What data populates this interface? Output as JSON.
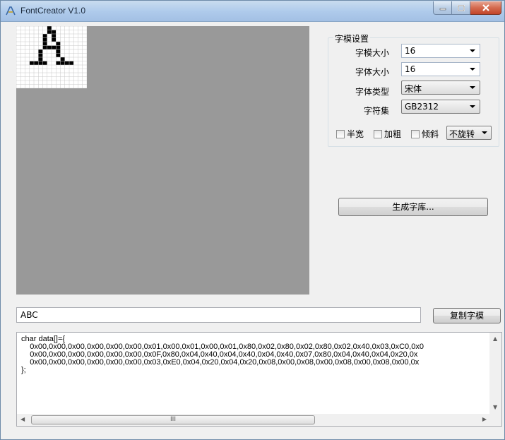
{
  "window": {
    "title": "FontCreator V1.0"
  },
  "settings": {
    "group_title": "字模设置",
    "font_matrix_size": {
      "label": "字模大小",
      "value": "16"
    },
    "font_size": {
      "label": "字体大小",
      "value": "16"
    },
    "font_type": {
      "label": "字体类型",
      "value": "宋体"
    },
    "charset": {
      "label": "字符集",
      "value": "GB2312"
    },
    "half_width": {
      "label": "半宽",
      "checked": false
    },
    "bold": {
      "label": "加粗",
      "checked": false
    },
    "italic": {
      "label": "倾斜",
      "checked": false
    },
    "rotation": {
      "value": "不旋转"
    }
  },
  "generate_button": "生成字库...",
  "text_input": {
    "value": "ABC"
  },
  "copy_button": "复制字模",
  "output": {
    "lines": [
      "char data[]={",
      "    0x00,0x00,0x00,0x00,0x00,0x00,0x01,0x00,0x01,0x00,0x01,0x80,0x02,0x80,0x02,0x80,0x02,0x40,0x03,0xC0,0x0",
      "    0x00,0x00,0x00,0x00,0x00,0x00,0x0F,0x80,0x04,0x40,0x04,0x40,0x04,0x40,0x07,0x80,0x04,0x40,0x04,0x20,0x",
      "    0x00,0x00,0x00,0x00,0x00,0x00,0x03,0xE0,0x04,0x20,0x04,0x20,0x08,0x00,0x08,0x00,0x08,0x00,0x08,0x00,0x",
      "};"
    ]
  },
  "hscroll_thumb_glyph": "III",
  "preview": {
    "grid_cols": 16,
    "grid_rows": 16,
    "glyph_rows": [
      "0000000100000000",
      "0000000110000000",
      "0000001010000000",
      "0000001010000000",
      "0000001001000000",
      "0000001111000000",
      "0000010001000000",
      "0000010001000000",
      "0000010000100000",
      "0001111001111000",
      "0000000000000000",
      "0000000000000000",
      "0000000000000000",
      "0000000000000000",
      "0000000000000000",
      "0000000000000000"
    ]
  },
  "colors": {
    "canvas": "#999999",
    "pixel_on": "#000000",
    "grid_line": "#c8c8c8"
  }
}
